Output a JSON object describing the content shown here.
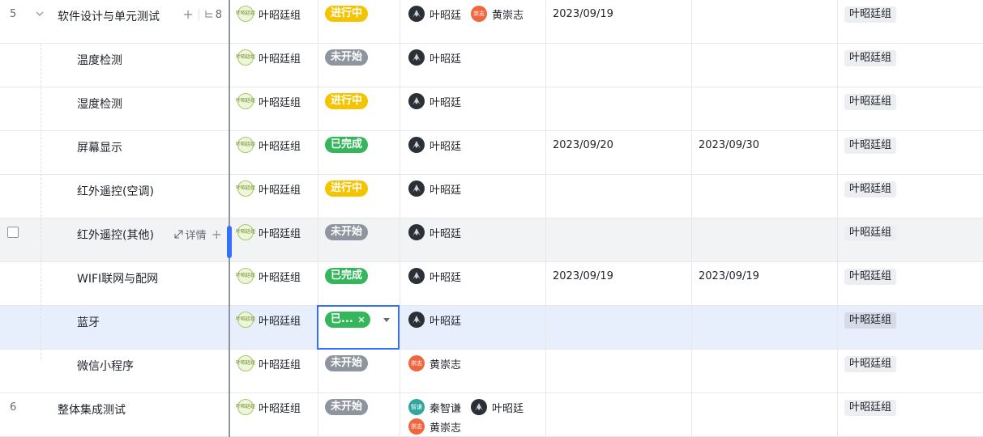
{
  "parent_task": {
    "number": "5",
    "name": "软件设计与单元测试",
    "subtask_count": "8",
    "team": "叶昭廷组",
    "status": "进行中",
    "assignees": [
      "叶昭廷",
      "黄崇志"
    ],
    "start_date": "2023/09/19",
    "end_date": "",
    "owner": "叶昭廷组"
  },
  "subtasks": [
    {
      "name": "温度检测",
      "team": "叶昭廷组",
      "status": "未开始",
      "assignees": [
        "叶昭廷"
      ],
      "start_date": "",
      "end_date": "",
      "owner": "叶昭廷组"
    },
    {
      "name": "湿度检测",
      "team": "叶昭廷组",
      "status": "进行中",
      "assignees": [
        "叶昭廷"
      ],
      "start_date": "",
      "end_date": "",
      "owner": "叶昭廷组"
    },
    {
      "name": "屏幕显示",
      "team": "叶昭廷组",
      "status": "已完成",
      "assignees": [
        "叶昭廷"
      ],
      "start_date": "2023/09/20",
      "end_date": "2023/09/30",
      "owner": "叶昭廷组"
    },
    {
      "name": "红外遥控(空调)",
      "team": "叶昭廷组",
      "status": "进行中",
      "assignees": [
        "叶昭廷"
      ],
      "start_date": "",
      "end_date": "",
      "owner": "叶昭廷组"
    },
    {
      "name": "红外遥控(其他)",
      "team": "叶昭廷组",
      "status": "未开始",
      "assignees": [
        "叶昭廷"
      ],
      "start_date": "",
      "end_date": "",
      "owner": "叶昭廷组",
      "detail_label": "详情"
    },
    {
      "name": "WIFI联网与配网",
      "team": "叶昭廷组",
      "status": "已完成",
      "assignees": [
        "叶昭廷"
      ],
      "start_date": "2023/09/19",
      "end_date": "2023/09/19",
      "owner": "叶昭廷组"
    },
    {
      "name": "蓝牙",
      "team": "叶昭廷组",
      "status": "已...",
      "assignees": [
        "叶昭廷"
      ],
      "start_date": "",
      "end_date": "",
      "owner": "叶昭廷组"
    },
    {
      "name": "微信小程序",
      "team": "叶昭廷组",
      "status": "未开始",
      "assignees": [
        "黄崇志"
      ],
      "start_date": "",
      "end_date": "",
      "owner": "叶昭廷组"
    }
  ],
  "next_task": {
    "number": "6",
    "name": "整体集成测试",
    "team": "叶昭廷组",
    "status": "未开始",
    "assignees": [
      "秦智谦",
      "叶昭廷",
      "黄崇志"
    ],
    "start_date": "",
    "end_date": "",
    "owner": "叶昭廷组"
  },
  "team_logo_text": "叶昭廷组",
  "avatar_text": {
    "黄崇志": "崇志",
    "秦智谦": "智谦"
  },
  "status_colors": {
    "进行中": "#f5c400",
    "未开始": "#8f959e",
    "已完成": "#34b75a"
  },
  "selection_color": "#3370ff"
}
